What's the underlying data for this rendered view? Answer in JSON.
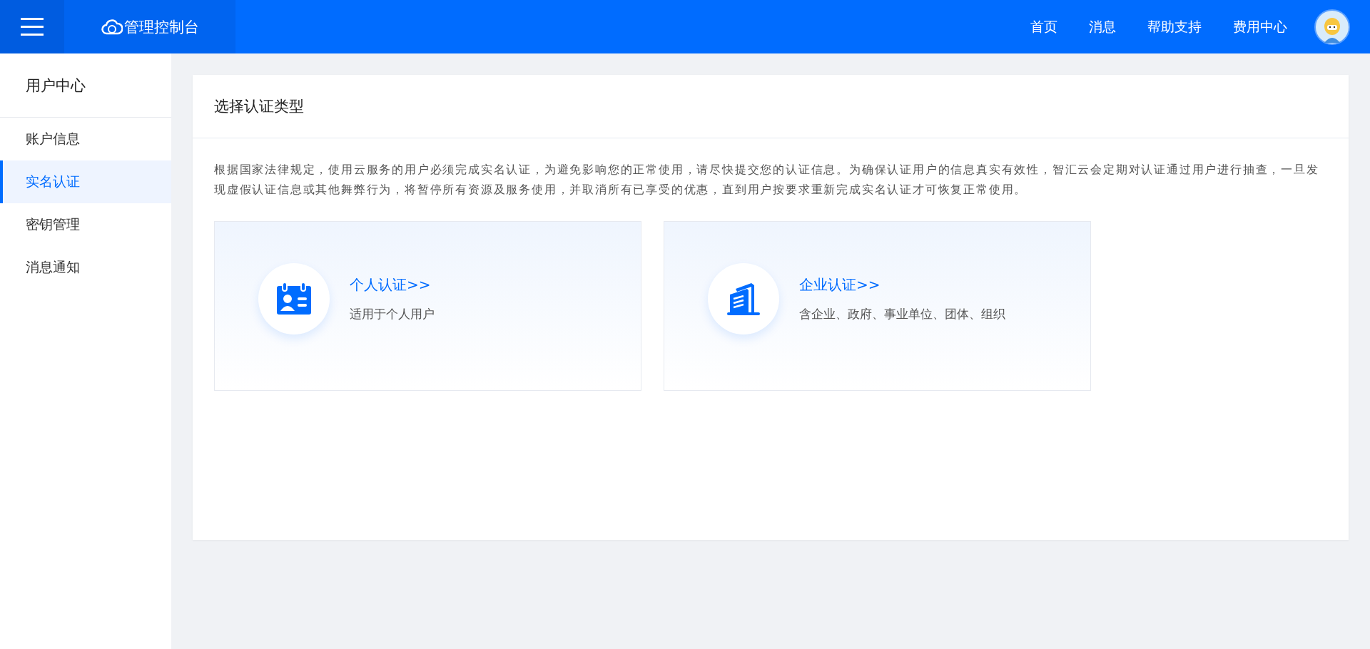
{
  "header": {
    "logo_text": "管理控制台",
    "nav": [
      "首页",
      "消息",
      "帮助支持",
      "费用中心"
    ]
  },
  "sidebar": {
    "title": "用户中心",
    "items": [
      {
        "label": "账户信息",
        "selected": false
      },
      {
        "label": "实名认证",
        "selected": true
      },
      {
        "label": "密钥管理",
        "selected": false
      },
      {
        "label": "消息通知",
        "selected": false
      }
    ]
  },
  "panel": {
    "title": "选择认证类型",
    "notice": "根据国家法律规定，使用云服务的用户必须完成实名认证，为避免影响您的正常使用，请尽快提交您的认证信息。为确保认证用户的信息真实有效性，智汇云会定期对认证通过用户进行抽查，一旦发现虚假认证信息或其他舞弊行为，将暂停所有资源及服务使用，并取消所有已享受的优惠，直到用户按要求重新完成实名认证才可恢复正常使用。",
    "options": [
      {
        "kind": "personal",
        "title": "个人认证>>",
        "subtitle": "适用于个人用户"
      },
      {
        "kind": "enterprise",
        "title": "企业认证>>",
        "subtitle": "含企业、政府、事业单位、团体、组织"
      }
    ]
  }
}
